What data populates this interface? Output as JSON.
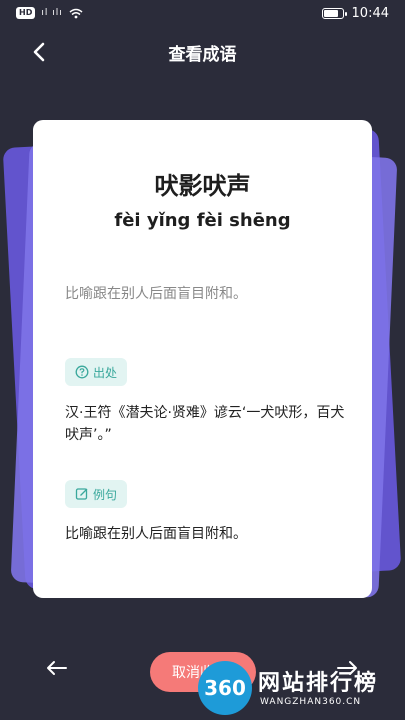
{
  "status": {
    "hd_badge": "HD",
    "signal_left": "ıl ılı",
    "time": "10:44",
    "battery_level": 0.7
  },
  "nav": {
    "title": "查看成语",
    "back_icon": "chevron-left-icon"
  },
  "card": {
    "idiom": "吠影吠声",
    "pinyin": "fèi yǐng fèi shēng",
    "meaning": "比喻跟在别人后面盲目附和。",
    "source_tag": "出处",
    "source_text": "汉·王符《潜夫论·贤难》谚云‘一犬吠形，百犬吠声’。”",
    "example_tag": "例句",
    "example_text": "比喻跟在别人后面盲目附和。"
  },
  "bottom": {
    "cancel_label": "取消收藏",
    "prev_icon": "arrow-left-icon",
    "next_icon": "arrow-right-icon"
  },
  "watermark": {
    "logo_text": "360",
    "site_name": "网站排行榜",
    "url": "WANGZHAN360.CN"
  },
  "colors": {
    "background": "#2b2c3a",
    "card": "#ffffff",
    "stack": "#6c5ce7",
    "tag_bg": "#e2f4f2",
    "tag_text": "#3aa89c",
    "cancel": "#f57a78"
  }
}
